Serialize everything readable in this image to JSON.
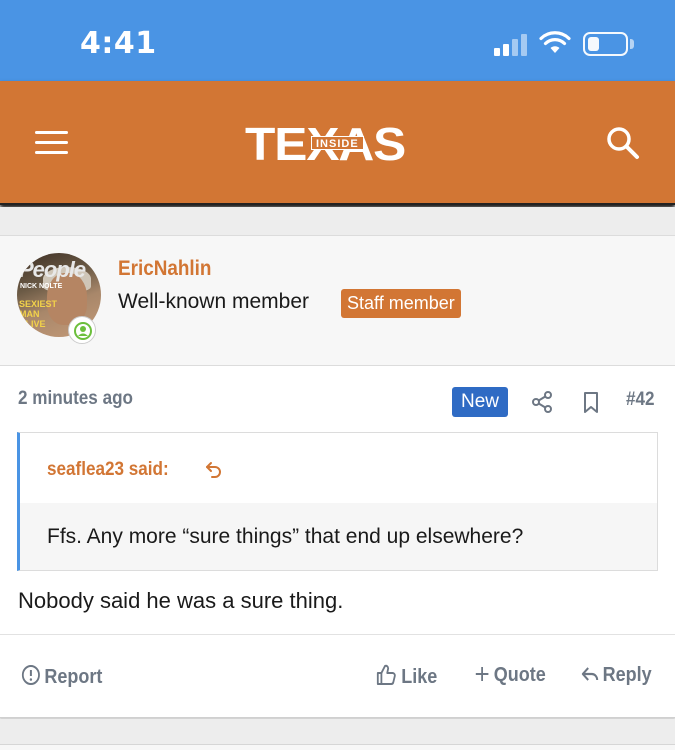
{
  "status_bar": {
    "time": "4:41",
    "signal_icon": "cellular-signal-icon",
    "wifi_icon": "wifi-icon",
    "battery_icon": "battery-icon",
    "battery_level": 0.25
  },
  "header": {
    "menu_icon": "hamburger-menu-icon",
    "logo_text": "TEXAS",
    "logo_inner_text": "INSIDE",
    "search_icon": "search-icon",
    "background_color": "#d27634"
  },
  "user": {
    "username": "EricNahlin",
    "title": "Well-known member",
    "staff_badge": "Staff member",
    "avatar_text": "People",
    "avatar_subtext": "NICK NOLTE",
    "avatar_side_text": "SEXIEST MAN ALIVE",
    "online_icon": "user-online-icon"
  },
  "post": {
    "time": "2 minutes ago",
    "new_badge": "New",
    "share_icon": "share-icon",
    "bookmark_icon": "bookmark-icon",
    "number": "#42",
    "quote": {
      "author": "seaflea23 said:",
      "jump_icon": "jump-to-quote-icon",
      "text": "Ffs. Any more “sure things” that end up elsewhere?"
    },
    "body": "Nobody said he was a sure thing.",
    "actions": {
      "report": "Report",
      "like": "Like",
      "quote": "Quote",
      "reply": "Reply"
    }
  },
  "colors": {
    "status_bar": "#4a94e4",
    "accent": "#d27634",
    "new_badge": "#2f6bc4",
    "meta_text": "#6d7784"
  }
}
